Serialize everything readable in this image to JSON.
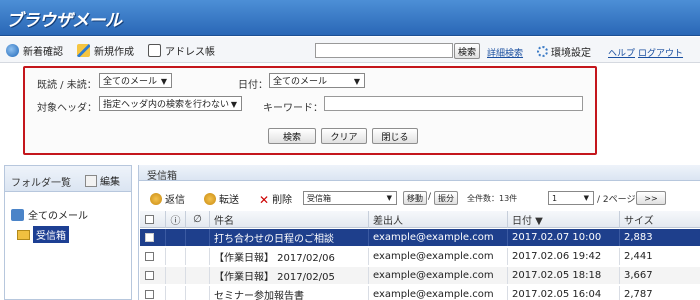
{
  "app": {
    "title": "ブラウザメール"
  },
  "toolbar": {
    "check_new": "新着確認",
    "compose": "新規作成",
    "address_book": "アドレス帳",
    "search_button": "検索",
    "advanced_search": "詳細検索",
    "settings": "環境設定",
    "help": "ヘルプ",
    "logout": "ログアウト"
  },
  "search_panel": {
    "read_label": "既読 / 未読：",
    "read_value": "全てのメール",
    "date_label": "日付：",
    "date_value": "全てのメール",
    "header_label": "対象ヘッダ：",
    "header_value": "指定ヘッダ内の検索を行わない",
    "keyword_label": "キーワード：",
    "keyword_value": "",
    "search": "検索",
    "clear": "クリア",
    "close": "閉じる"
  },
  "folders": {
    "title": "フォルダ一覧",
    "edit": "編集",
    "root": "全てのメール",
    "inbox": "受信箱"
  },
  "mail": {
    "folder_title": "受信箱",
    "reply": "返信",
    "forward": "転送",
    "delete": "削除",
    "move_target": "受信箱",
    "move": "移動",
    "separator": "/",
    "dispose": "振分",
    "total": "全件数：13件",
    "page_value": "1",
    "page_total": "/ 2ページ",
    "next": ">>",
    "columns": {
      "subject": "件名",
      "from": "差出人",
      "date": "日付 ▼",
      "size": "サイズ"
    },
    "rows": [
      {
        "subject": "打ち合わせの日程のご相談",
        "from": "example@example.com",
        "date": "2017.02.07 10:00",
        "size": "2,883"
      },
      {
        "subject": "【作業日報】 2017/02/06",
        "from": "example@example.com",
        "date": "2017.02.06 19:42",
        "size": "2,441"
      },
      {
        "subject": "【作業日報】 2017/02/05",
        "from": "example@example.com",
        "date": "2017.02.05 18:18",
        "size": "3,667"
      },
      {
        "subject": "セミナー参加報告書",
        "from": "example@example.com",
        "date": "2017.02.05 16:04",
        "size": "2,787"
      }
    ]
  },
  "colors": {
    "accent": "#2a67b6",
    "selected_row": "#1e3f8c",
    "highlight_border": "#c4161c"
  }
}
